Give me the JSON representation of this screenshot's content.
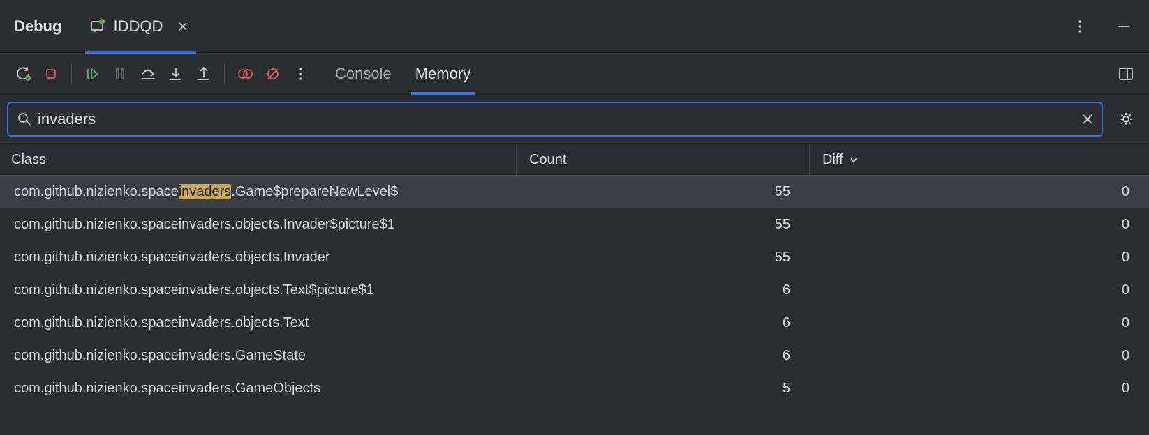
{
  "window": {
    "title": "Debug"
  },
  "run_tab": {
    "label": "IDDQD"
  },
  "view_tabs": {
    "console": "Console",
    "memory": "Memory",
    "active": "memory"
  },
  "search": {
    "value": "invaders"
  },
  "columns": {
    "class": "Class",
    "count": "Count",
    "diff": "Diff"
  },
  "rows": [
    {
      "pre": "com.github.nizienko.space",
      "hl": "invaders",
      "post": ".Game$prepareNewLevel$",
      "count": 55,
      "diff": 0,
      "selected": true
    },
    {
      "pre": "com.github.nizienko.spaceinvaders.objects.Invader$picture$1",
      "hl": "",
      "post": "",
      "count": 55,
      "diff": 0
    },
    {
      "pre": "com.github.nizienko.spaceinvaders.objects.Invader",
      "hl": "",
      "post": "",
      "count": 55,
      "diff": 0
    },
    {
      "pre": "com.github.nizienko.spaceinvaders.objects.Text$picture$1",
      "hl": "",
      "post": "",
      "count": 6,
      "diff": 0
    },
    {
      "pre": "com.github.nizienko.spaceinvaders.objects.Text",
      "hl": "",
      "post": "",
      "count": 6,
      "diff": 0
    },
    {
      "pre": "com.github.nizienko.spaceinvaders.GameState",
      "hl": "",
      "post": "",
      "count": 6,
      "diff": 0
    },
    {
      "pre": "com.github.nizienko.spaceinvaders.GameObjects",
      "hl": "",
      "post": "",
      "count": 5,
      "diff": 0
    }
  ]
}
